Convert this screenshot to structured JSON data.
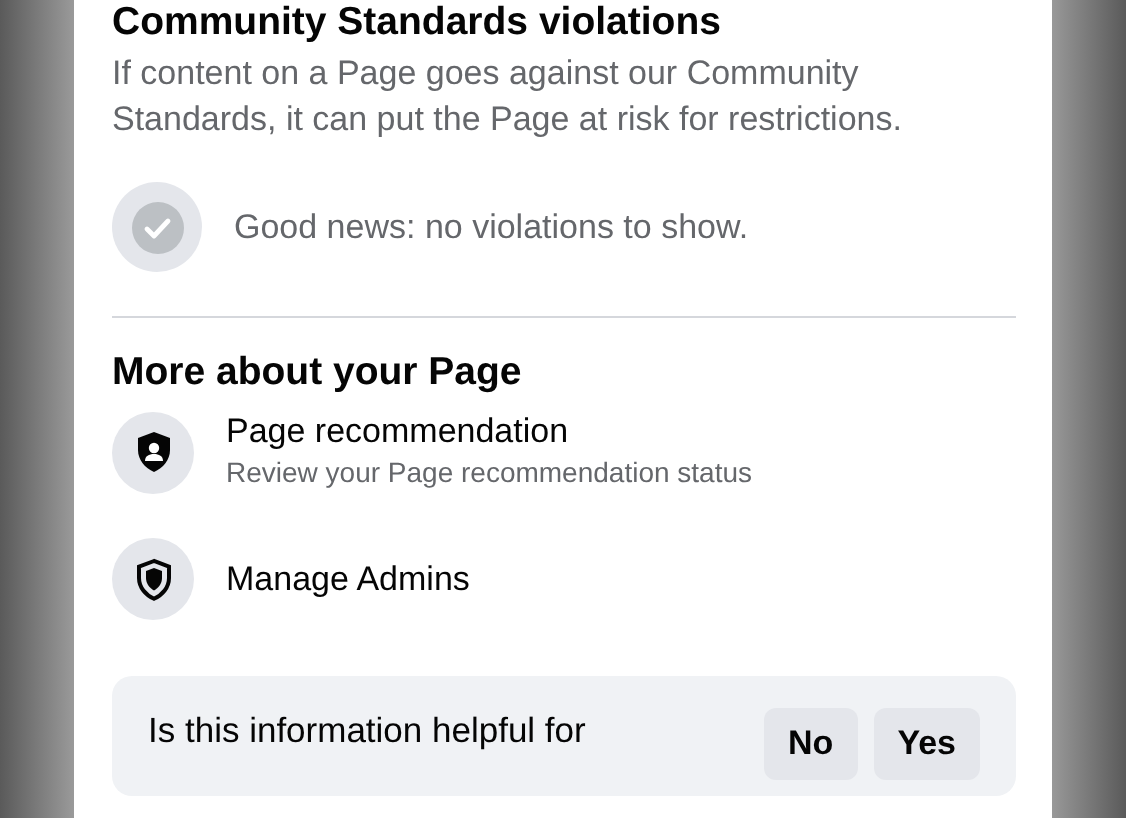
{
  "violations": {
    "title": "Community Standards violations",
    "description": "If content on a Page goes against our Community Standards, it can put the Page at risk for restrictions.",
    "status": "Good news: no violations to show."
  },
  "more": {
    "title": "More about your Page",
    "items": [
      {
        "kind": "recommendation",
        "label": "Page recommendation",
        "subtitle": "Review your Page recommendation status"
      },
      {
        "kind": "admins",
        "label": "Manage Admins"
      }
    ]
  },
  "feedback": {
    "question": "Is this information helpful for",
    "buttons": [
      "No",
      "Yes"
    ]
  }
}
